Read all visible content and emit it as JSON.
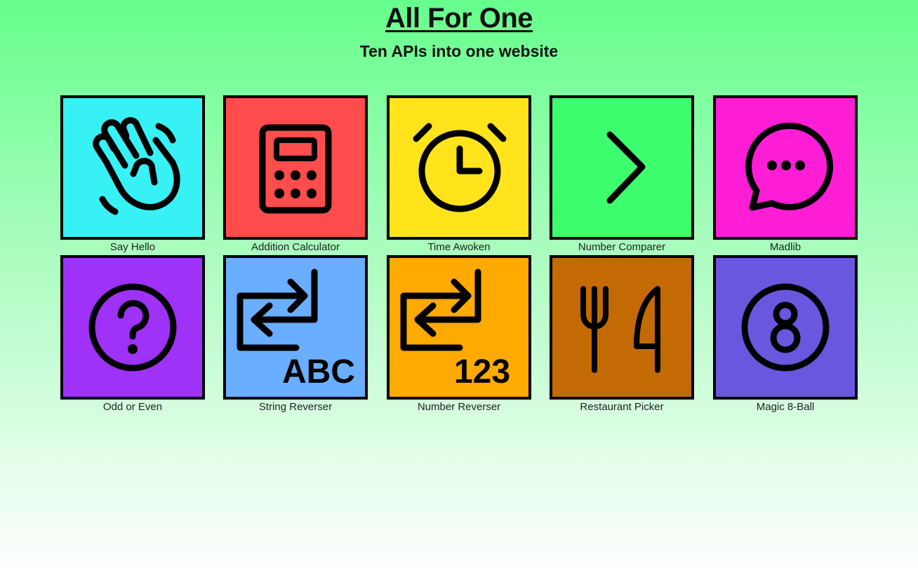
{
  "header": {
    "title": "All For One",
    "subtitle": "Ten APIs into one website"
  },
  "tiles": [
    {
      "label": "Say Hello",
      "color": "#37f1f5",
      "icon": "waving-hand-icon"
    },
    {
      "label": "Addition Calculator",
      "color": "#ff4c4c",
      "icon": "calculator-icon"
    },
    {
      "label": "Time Awoken",
      "color": "#ffe41c",
      "icon": "alarm-clock-icon"
    },
    {
      "label": "Number Comparer",
      "color": "#3dff6e",
      "icon": "chevron-right-icon"
    },
    {
      "label": "Madlib",
      "color": "#ff1ed6",
      "icon": "chat-bubble-icon"
    },
    {
      "label": "Odd or Even",
      "color": "#9e32f7",
      "icon": "question-circle-icon"
    },
    {
      "label": "String Reverser",
      "color": "#6aaeff",
      "icon": "swap-arrows-icon",
      "badge": "ABC"
    },
    {
      "label": "Number Reverser",
      "color": "#ffaa00",
      "icon": "swap-arrows-icon",
      "badge": "123"
    },
    {
      "label": "Restaurant Picker",
      "color": "#c46a04",
      "icon": "fork-knife-icon"
    },
    {
      "label": "Magic 8-Ball",
      "color": "#6957e0",
      "icon": "eight-ball-icon"
    }
  ]
}
